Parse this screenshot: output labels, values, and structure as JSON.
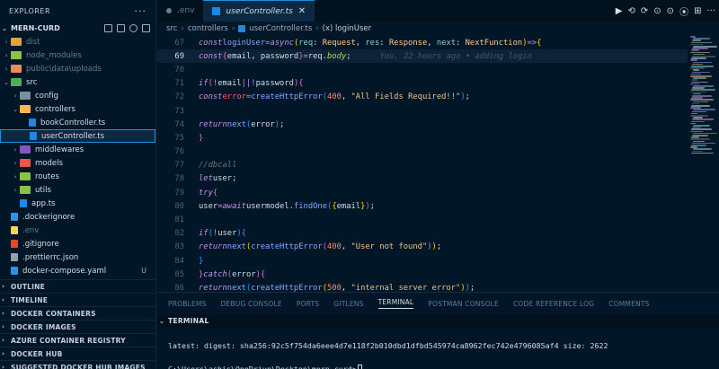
{
  "sidebar": {
    "header": "EXPLORER",
    "more": "···",
    "project": "MERN-CURD",
    "items": [
      {
        "label": "dist",
        "indent": 1,
        "chev": "›",
        "color": "#e0a340",
        "dim": true
      },
      {
        "label": "node_modules",
        "indent": 1,
        "chev": "›",
        "color": "#8bc34a",
        "dim": true
      },
      {
        "label": "public\\data\\uploads",
        "indent": 1,
        "chev": "›",
        "color": "#ec8a5b",
        "dim": true
      },
      {
        "label": "src",
        "indent": 1,
        "chev": "⌄",
        "color": "#4caf50"
      },
      {
        "label": "config",
        "indent": 2,
        "chev": "›",
        "color": "#78909c"
      },
      {
        "label": "controllers",
        "indent": 2,
        "chev": "⌄",
        "color": "#ffb74d"
      },
      {
        "label": "bookController.ts",
        "indent": 3,
        "chev": "",
        "color": "#1e88e5"
      },
      {
        "label": "userController.ts",
        "indent": 3,
        "chev": "",
        "color": "#1e88e5",
        "selected": true
      },
      {
        "label": "middlewares",
        "indent": 2,
        "chev": "›",
        "color": "#7e57c2"
      },
      {
        "label": "models",
        "indent": 2,
        "chev": "›",
        "color": "#ef5350"
      },
      {
        "label": "routes",
        "indent": 2,
        "chev": "›",
        "color": "#8bc34a"
      },
      {
        "label": "utils",
        "indent": 2,
        "chev": "›",
        "color": "#8bc34a"
      },
      {
        "label": "app.ts",
        "indent": 2,
        "chev": "",
        "color": "#1e88e5"
      },
      {
        "label": ".dockerignore",
        "indent": 1,
        "chev": "",
        "color": "#2196f3"
      },
      {
        "label": ".env",
        "indent": 1,
        "chev": "",
        "color": "#ffd54f",
        "dim": true
      },
      {
        "label": ".gitignore",
        "indent": 1,
        "chev": "",
        "color": "#e64a19"
      },
      {
        "label": ".prettierrc.json",
        "indent": 1,
        "chev": "",
        "color": "#90a4ae"
      },
      {
        "label": "docker-compose.yaml",
        "indent": 1,
        "chev": "",
        "color": "#2196f3",
        "badge": "U"
      }
    ],
    "panels": [
      "OUTLINE",
      "TIMELINE",
      "DOCKER CONTAINERS",
      "DOCKER IMAGES",
      "AZURE CONTAINER REGISTRY",
      "DOCKER HUB",
      "SUGGESTED DOCKER HUB IMAGES"
    ]
  },
  "tabs": [
    {
      "label": ".env",
      "active": false
    },
    {
      "label": "userController.ts",
      "active": true,
      "close": "✕"
    }
  ],
  "toolbar_icons": [
    "▶",
    "⟲",
    "⟳",
    "⊙",
    "⊙",
    "⦿",
    "⊞",
    "···"
  ],
  "breadcrumb": [
    "src",
    "controllers",
    "userController.ts",
    "(x) loginUser"
  ],
  "breadcrumb_sep": "›",
  "code": {
    "start": 67,
    "current": 69,
    "blame": "You, 22 hours ago • adding login"
  },
  "panel": {
    "tabs": [
      "PROBLEMS",
      "DEBUG CONSOLE",
      "PORTS",
      "GITLENS",
      "TERMINAL",
      "POSTMAN CONSOLE",
      "CODE REFERENCE LOG",
      "COMMENTS"
    ],
    "active_tab": "TERMINAL",
    "terminal_title": "TERMINAL",
    "lines": [
      "",
      "latest: digest: sha256:92c5f754da6eee4d7e118f2b010dbd1dfbd545974ca8962fec742e4796085af4 size: 2622",
      "",
      "C:\\Users\\ashis\\OneDrive\\Desktop\\mern-curd>"
    ]
  }
}
